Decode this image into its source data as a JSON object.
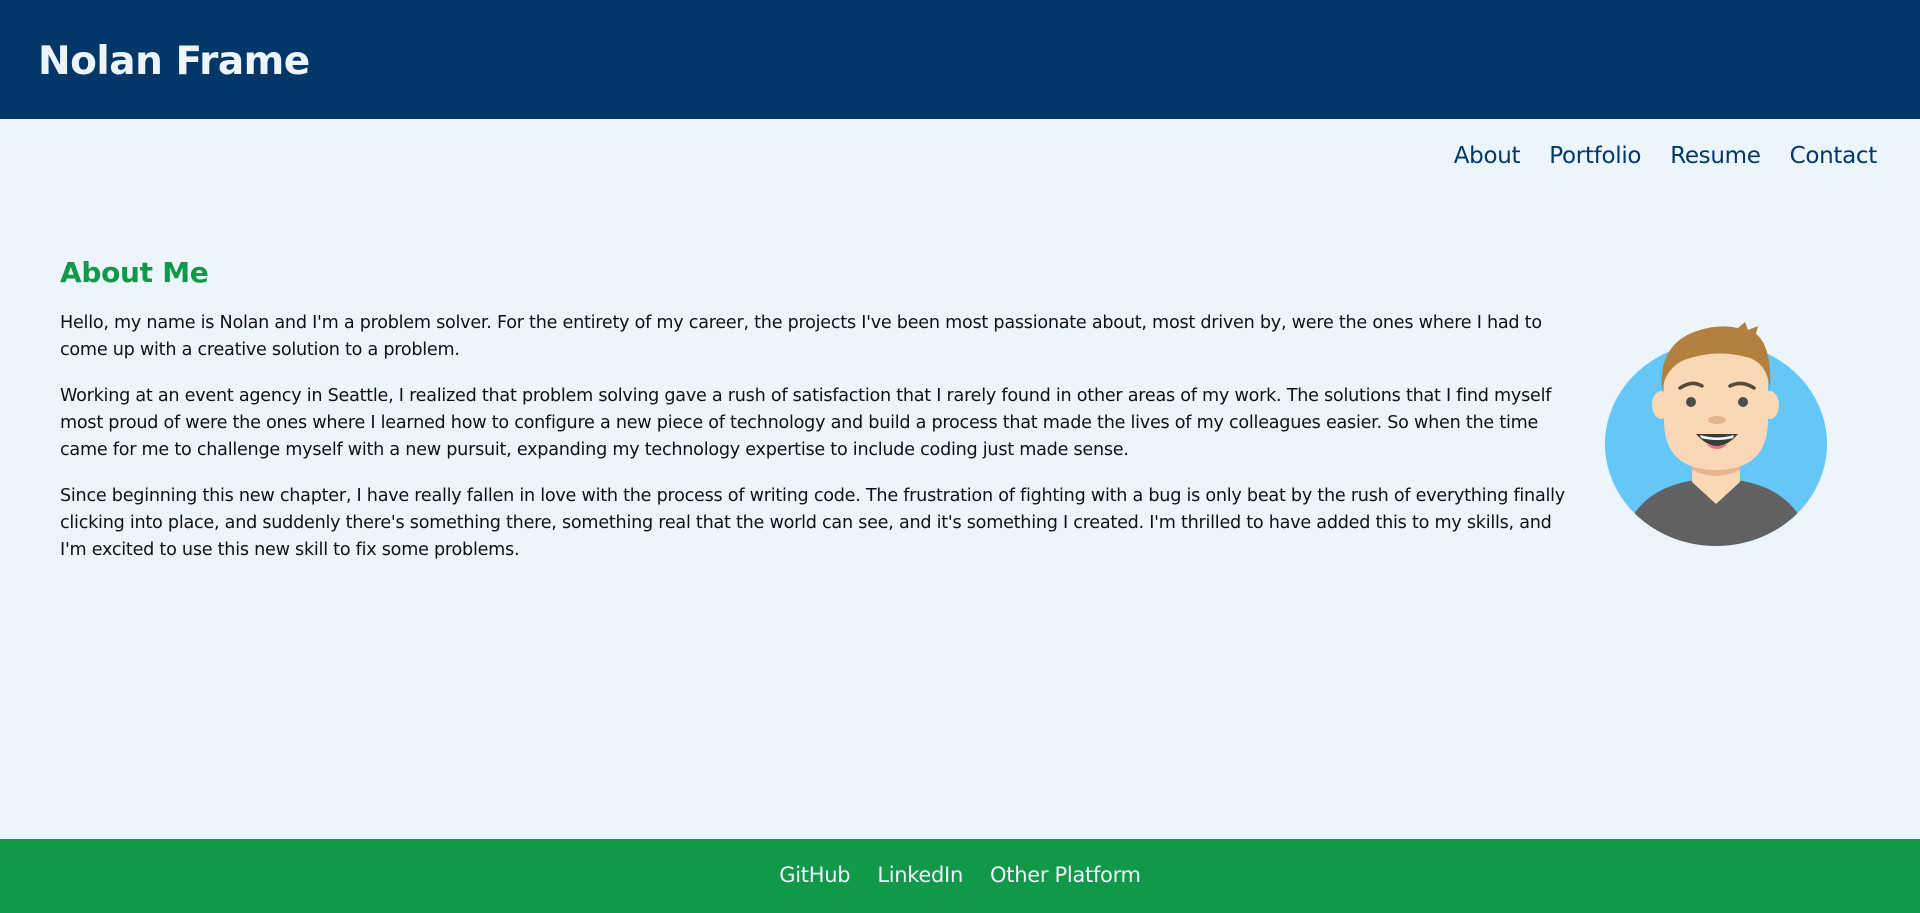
{
  "header": {
    "title": "Nolan Frame"
  },
  "nav": {
    "items": [
      {
        "label": "About"
      },
      {
        "label": "Portfolio"
      },
      {
        "label": "Resume"
      },
      {
        "label": "Contact"
      }
    ]
  },
  "about": {
    "heading": "About Me",
    "paragraphs": [
      "Hello, my name is Nolan and I'm a problem solver. For the entirety of my career, the projects I've been most passionate about, most driven by, were the ones where I had to come up with a creative solution to a problem.",
      "Working at an event agency in Seattle, I realized that problem solving gave a rush of satisfaction that I rarely found in other areas of my work. The solutions that I find myself most proud of were the ones where I learned how to configure a new piece of technology and build a process that made the lives of my colleagues easier. So when the time came for me to challenge myself with a new pursuit, expanding my technology expertise to include coding just made sense.",
      "Since beginning this new chapter, I have really fallen in love with the process of writing code. The frustration of fighting with a bug is only beat by the rush of everything finally clicking into place, and suddenly there's something there, something real that the world can see, and it's something I created. I'm thrilled to have added this to my skills, and I'm excited to use this new skill to fix some problems."
    ],
    "avatar_icon": "smiling-man-avatar"
  },
  "footer": {
    "links": [
      {
        "label": "GitHub"
      },
      {
        "label": "LinkedIn"
      },
      {
        "label": "Other Platform"
      }
    ]
  },
  "colors": {
    "header_bg": "#043668",
    "page_bg": "#ecf5fc",
    "accent_green": "#119849",
    "avatar_bg": "#65c6f8"
  }
}
